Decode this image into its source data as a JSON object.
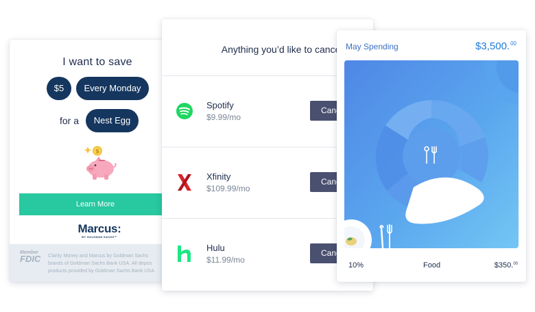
{
  "save_card": {
    "title": "I want to save",
    "amount": "$5",
    "frequency": "Every Monday",
    "for_label": "for a",
    "goal": "Nest Egg",
    "cta": "Learn More",
    "brand": "Marcus:",
    "brand_sub": "BY GOLDMAN SACHS™",
    "fdic_member": "Member",
    "fdic": "FDIC",
    "disclaimer_lines": [
      "Clarity Money and Marcus by Goldman Sachs",
      "brands of Goldman Sachs Bank USA. All depos",
      "products provided by Goldman Sachs Bank USA"
    ],
    "accent_color": "#28c8a0",
    "pill_color": "#15365e"
  },
  "cancel_card": {
    "title": "Anything you’d like to cancel?",
    "subscriptions": [
      {
        "name": "Spotify",
        "price": "$9.99/mo",
        "action": "Cancel",
        "icon": "spotify-icon"
      },
      {
        "name": "Xfinity",
        "price": "$109.99/mo",
        "action": "Cancel",
        "icon": "xfinity-icon"
      },
      {
        "name": "Hulu",
        "price": "$11.99/mo",
        "action": "Cancel",
        "icon": "hulu-icon"
      }
    ]
  },
  "spending_card": {
    "title": "May Spending",
    "total": "$3,500.",
    "total_cents": "00",
    "category_percent": "10%",
    "category": "Food",
    "category_amount": "$350.",
    "category_cents": "00",
    "icon": "utensils-icon"
  }
}
